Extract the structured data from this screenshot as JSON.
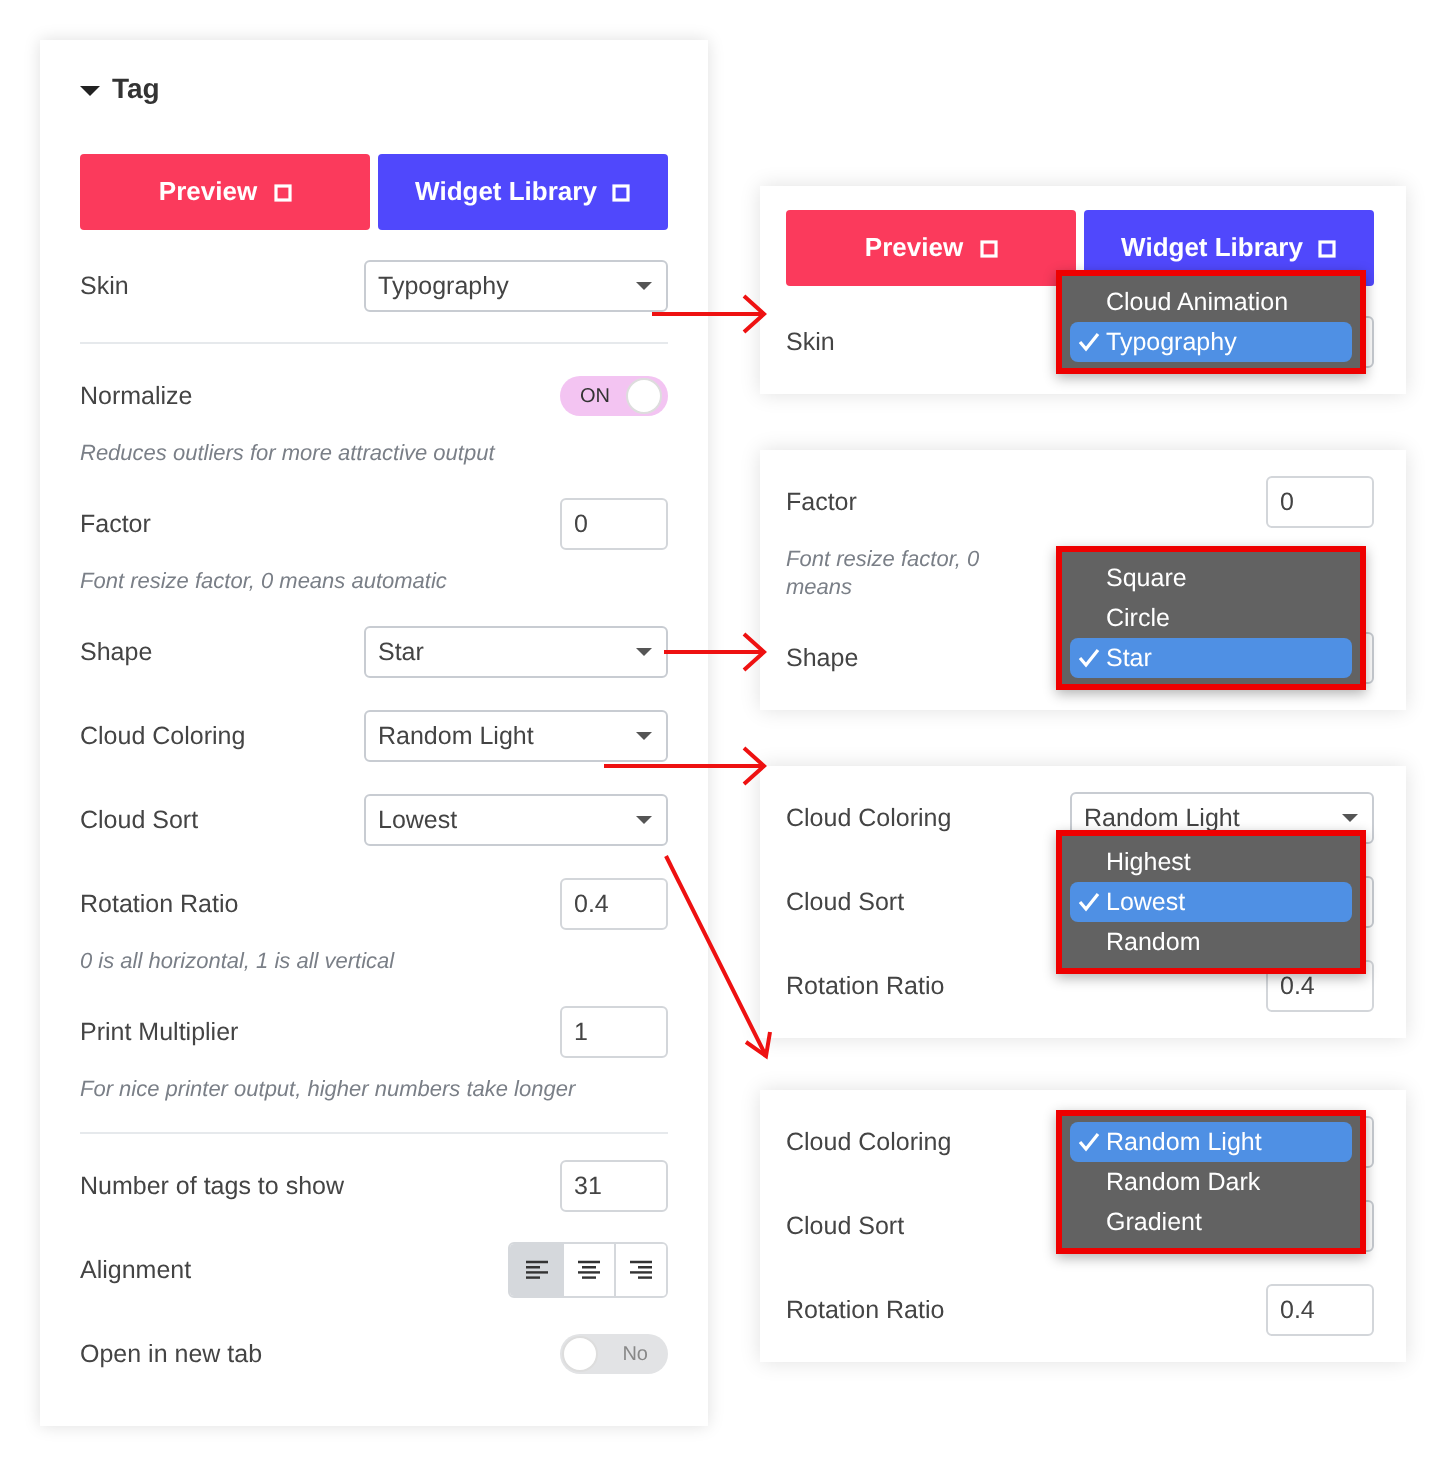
{
  "panel": {
    "title": "Tag",
    "expanded": true,
    "buttons": [
      {
        "label": "Preview",
        "kind": "preview"
      },
      {
        "label": "Widget Library",
        "kind": "library"
      }
    ],
    "sections": [
      [
        {
          "kind": "select",
          "label": "Skin",
          "value": "Typography"
        }
      ],
      [
        {
          "kind": "switch",
          "label": "Normalize",
          "on": true,
          "text": "ON",
          "hint": "Reduces outliers for more attractive output"
        },
        {
          "kind": "number",
          "label": "Factor",
          "value": "0",
          "hint": "Font resize factor, 0 means automatic"
        },
        {
          "kind": "select",
          "label": "Shape",
          "value": "Star"
        },
        {
          "kind": "select",
          "label": "Cloud Coloring",
          "value": "Random Light"
        },
        {
          "kind": "select",
          "label": "Cloud Sort",
          "value": "Lowest"
        },
        {
          "kind": "number",
          "label": "Rotation Ratio",
          "value": "0.4",
          "hint": "0 is all horizontal, 1 is all vertical"
        },
        {
          "kind": "number",
          "label": "Print Multiplier",
          "value": "1",
          "hint": "For nice printer output, higher numbers take longer"
        }
      ],
      [
        {
          "kind": "number",
          "label": "Number of tags to show",
          "value": "31"
        },
        {
          "kind": "align",
          "label": "Alignment",
          "options": [
            {
              "kind": "left",
              "selected": true
            },
            {
              "kind": "center",
              "selected": false
            },
            {
              "kind": "right",
              "selected": false
            }
          ]
        },
        {
          "kind": "switch",
          "label": "Open in new tab",
          "on": false,
          "text": "No"
        }
      ]
    ]
  },
  "callouts": [
    {
      "rows": [
        {
          "kind": "buttons",
          "buttons": [
            {
              "label": "Preview",
              "kind": "preview"
            },
            {
              "label": "Widget Library",
              "kind": "library"
            }
          ]
        },
        {
          "kind": "select",
          "label": "Skin",
          "menu": [
            {
              "label": "Cloud Animation",
              "selected": false
            },
            {
              "label": "Typography",
              "selected": true
            }
          ]
        }
      ]
    },
    {
      "rows": [
        {
          "kind": "number",
          "label": "Factor",
          "value": "0",
          "hint": "Font resize factor, 0 means"
        },
        {
          "kind": "select",
          "label": "Shape",
          "menu": [
            {
              "label": "Square",
              "selected": false
            },
            {
              "label": "Circle",
              "selected": false
            },
            {
              "label": "Star",
              "selected": true
            }
          ]
        }
      ]
    },
    {
      "rows": [
        {
          "kind": "select",
          "label": "Cloud Coloring",
          "value": "Random Light"
        },
        {
          "kind": "select",
          "label": "Cloud Sort",
          "menu": [
            {
              "label": "Highest",
              "selected": false
            },
            {
              "label": "Lowest",
              "selected": true
            },
            {
              "label": "Random",
              "selected": false
            }
          ]
        },
        {
          "kind": "number",
          "label": "Rotation Ratio",
          "value": "0.4"
        }
      ]
    },
    {
      "rows": [
        {
          "kind": "select",
          "label": "Cloud Coloring",
          "menu": [
            {
              "label": "Random Light",
              "selected": true
            },
            {
              "label": "Random Dark",
              "selected": false
            },
            {
              "label": "Gradient",
              "selected": false
            }
          ]
        },
        {
          "kind": "select",
          "label": "Cloud Sort"
        },
        {
          "kind": "number",
          "label": "Rotation Ratio",
          "value": "0.4"
        }
      ]
    }
  ]
}
